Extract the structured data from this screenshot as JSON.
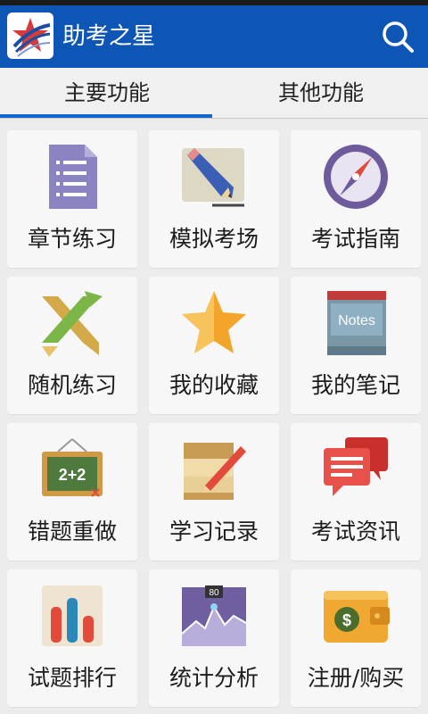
{
  "app": {
    "title": "助考之星",
    "accent_color": "#0d56b5",
    "logo_icon": "star-logo-icon",
    "search_icon": "search-icon"
  },
  "tabs": [
    {
      "label": "主要功能",
      "active": true
    },
    {
      "label": "其他功能",
      "active": false
    }
  ],
  "tiles": [
    {
      "label": "章节练习",
      "icon": "document-list-icon"
    },
    {
      "label": "模拟考场",
      "icon": "pencil-icon"
    },
    {
      "label": "考试指南",
      "icon": "compass-icon"
    },
    {
      "label": "随机练习",
      "icon": "shuffle-icon"
    },
    {
      "label": "我的收藏",
      "icon": "star-icon"
    },
    {
      "label": "我的笔记",
      "icon": "notes-book-icon",
      "icon_text": "Notes"
    },
    {
      "label": "错题重做",
      "icon": "chalkboard-icon",
      "icon_text": "2+2"
    },
    {
      "label": "学习记录",
      "icon": "paper-pencil-icon"
    },
    {
      "label": "考试资讯",
      "icon": "chat-bubbles-icon"
    },
    {
      "label": "试题排行",
      "icon": "bar-chart-icon"
    },
    {
      "label": "统计分析",
      "icon": "line-chart-icon",
      "icon_text": "80"
    },
    {
      "label": "注册/购买",
      "icon": "wallet-icon",
      "icon_text": "$"
    }
  ]
}
